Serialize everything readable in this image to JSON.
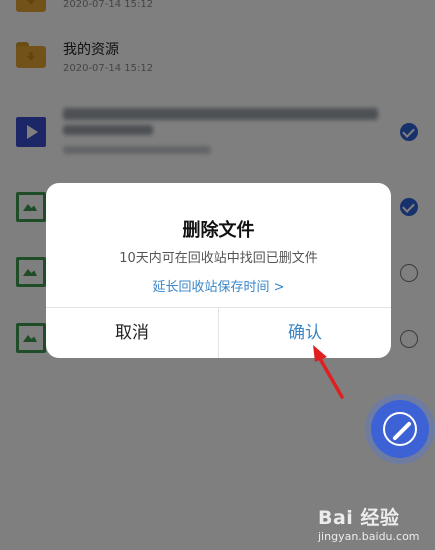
{
  "files": [
    {
      "name": "",
      "date": "2020-07-14 15:12",
      "type": "folder"
    },
    {
      "name": "我的资源",
      "date": "2020-07-14 15:12",
      "type": "folder"
    },
    {
      "name": "",
      "date": "",
      "type": "video",
      "checked": true
    },
    {
      "name": "",
      "date": "",
      "type": "image",
      "checked": true
    },
    {
      "name": "",
      "date": "",
      "type": "image",
      "checked": false
    },
    {
      "name": "",
      "date": "",
      "type": "image",
      "checked": false
    }
  ],
  "dialog": {
    "title": "删除文件",
    "message": "10天内可在回收站中找回已删文件",
    "link": "延长回收站保存时间 >",
    "cancel_label": "取消",
    "confirm_label": "确认"
  },
  "fab": {
    "icon": "compass-icon"
  },
  "watermark": {
    "brand": "Bai 经验",
    "url": "jingyan.baidu.com"
  },
  "colors": {
    "accent": "#3a86c8",
    "fab": "#3c62d6",
    "check": "#2f62d8"
  }
}
